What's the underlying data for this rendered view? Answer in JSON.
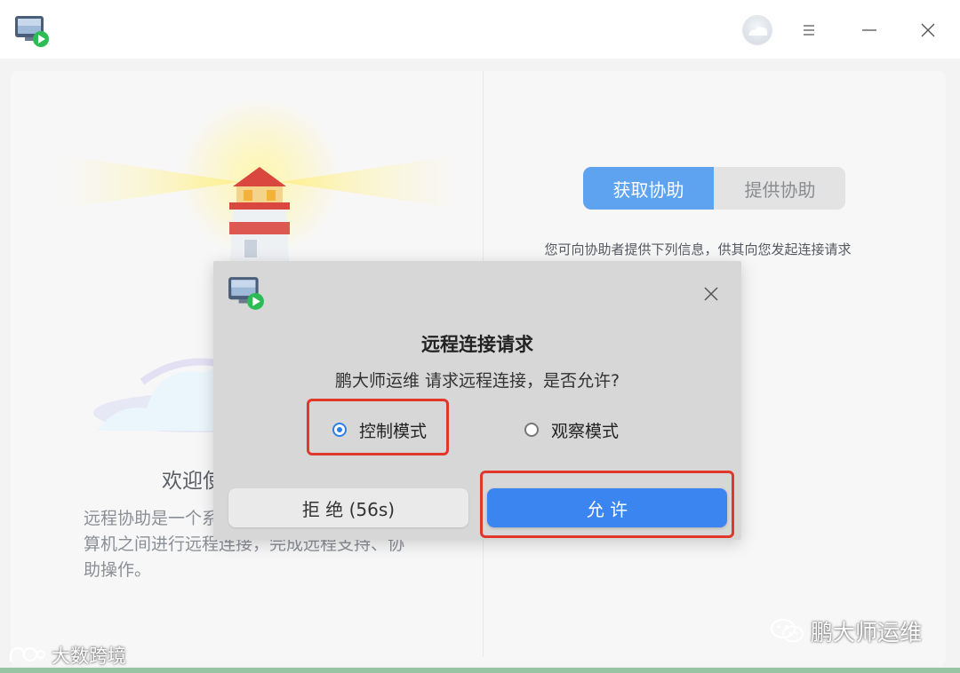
{
  "titlebar": {
    "icons": {
      "logo": "remote-assist-app-icon",
      "avatar": "user-avatar",
      "menu": "menu-icon",
      "minimize": "minimize-icon",
      "close": "close-icon"
    }
  },
  "left_panel": {
    "illustration": "lighthouse-illustration",
    "welcome_title": "欢迎使",
    "description": "远程协助是一个系\n算机之间进行远程连接，完成远程支持、协\n助操作。"
  },
  "right_panel": {
    "tabs": [
      {
        "label": "获取协助",
        "active": true
      },
      {
        "label": "提供协助",
        "active": false
      }
    ],
    "info_text": "您可向协助者提供下列信息，供其向您发起连接请求"
  },
  "dialog": {
    "title": "远程连接请求",
    "message": "鹏大师运维 请求远程连接，是否允许?",
    "options": [
      {
        "label": "控制模式",
        "checked": true
      },
      {
        "label": "观察模式",
        "checked": false
      }
    ],
    "deny_label": "拒 绝 (56s)",
    "allow_label": "允 许",
    "icons": {
      "logo": "remote-assist-app-icon",
      "close": "close-icon"
    }
  },
  "watermarks": {
    "right": "鹏大师运维",
    "left": "大数跨境"
  },
  "colors": {
    "accent": "#3b85f0",
    "tab_active": "#5ea3f0",
    "highlight": "#e0392b"
  }
}
